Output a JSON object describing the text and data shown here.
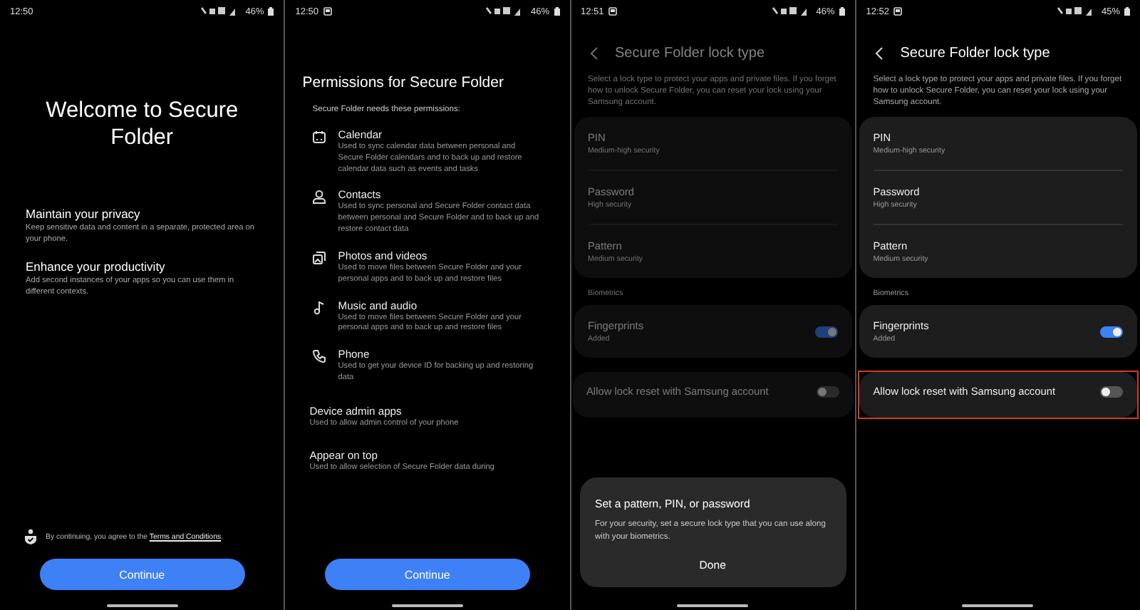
{
  "screens": [
    {
      "kind": "welcome",
      "dimmed": false,
      "status": {
        "time": "12:50",
        "battery": "46%",
        "notification": false
      },
      "title": "Welcome to Secure Folder",
      "sections": [
        {
          "heading": "Maintain your privacy",
          "text": "Keep sensitive data and content in a separate, protected area on your phone."
        },
        {
          "heading": "Enhance your productivity",
          "text": "Add second instances of your apps so you can use them in different contexts."
        }
      ],
      "terms": {
        "text": "By continuing, you agree to the ",
        "link": "Terms and Conditions",
        "end": "."
      },
      "button": "Continue"
    },
    {
      "kind": "permissions",
      "dimmed": false,
      "status": {
        "time": "12:50",
        "battery": "46%",
        "notification": true
      },
      "title": "Permissions for Secure Folder",
      "intro": "Secure Folder needs these permissions:",
      "permissions": [
        {
          "kind": "calendar",
          "title": "Calendar",
          "text": "Used to sync calendar data between personal and Secure Folder calendars and to back up and restore calendar data such as events and tasks"
        },
        {
          "kind": "person",
          "title": "Contacts",
          "text": "Used to sync personal and Secure Folder contact data between personal and Secure Folder and to back up and restore contact data"
        },
        {
          "kind": "photos",
          "title": "Photos and videos",
          "text": "Used to move files between Secure Folder and your personal apps and to back up and restore files"
        },
        {
          "kind": "music",
          "title": "Music and audio",
          "text": "Used to move files between Secure Folder and your personal apps and to back up and restore files"
        },
        {
          "kind": "phone",
          "title": "Phone",
          "text": "Used to get your device ID for backing up and restoring data"
        }
      ],
      "other": [
        {
          "title": "Device admin apps",
          "text": "Used to allow admin control of your phone"
        },
        {
          "title": "Appear on top",
          "text": "Used to allow selection of Secure Folder data during"
        }
      ],
      "button": "Continue"
    },
    {
      "kind": "lock",
      "dimmed": true,
      "status": {
        "time": "12:51",
        "battery": "46%",
        "notification": true
      },
      "title": "Secure Folder lock type",
      "description": "Select a lock type to protect your apps and private files. If you forget how to unlock Secure Folder, you can reset your lock using your Samsung account.",
      "options": [
        {
          "title": "PIN",
          "subtitle": "Medium-high security"
        },
        {
          "title": "Password",
          "subtitle": "High security"
        },
        {
          "title": "Pattern",
          "subtitle": "Medium security"
        }
      ],
      "section_label": "Biometrics",
      "biometrics": [
        {
          "title": "Fingerprints",
          "subtitle": "Added",
          "on": true
        }
      ],
      "reset": {
        "title": "Allow lock reset with Samsung account",
        "on": false,
        "highlighted": false
      },
      "dialog": {
        "title": "Set a pattern, PIN, or password",
        "text": "For your security, set a secure lock type that you can use along with your biometrics.",
        "button": "Done"
      }
    },
    {
      "kind": "lock",
      "dimmed": false,
      "status": {
        "time": "12:52",
        "battery": "45%",
        "notification": true
      },
      "title": "Secure Folder lock type",
      "description": "Select a lock type to protect your apps and private files. If you forget how to unlock Secure Folder, you can reset your lock using your Samsung account.",
      "options": [
        {
          "title": "PIN",
          "subtitle": "Medium-high security"
        },
        {
          "title": "Password",
          "subtitle": "High security"
        },
        {
          "title": "Pattern",
          "subtitle": "Medium security"
        }
      ],
      "section_label": "Biometrics",
      "biometrics": [
        {
          "title": "Fingerprints",
          "subtitle": "Added",
          "on": true
        }
      ],
      "reset": {
        "title": "Allow lock reset with Samsung account",
        "on": false,
        "highlighted": true
      }
    }
  ]
}
